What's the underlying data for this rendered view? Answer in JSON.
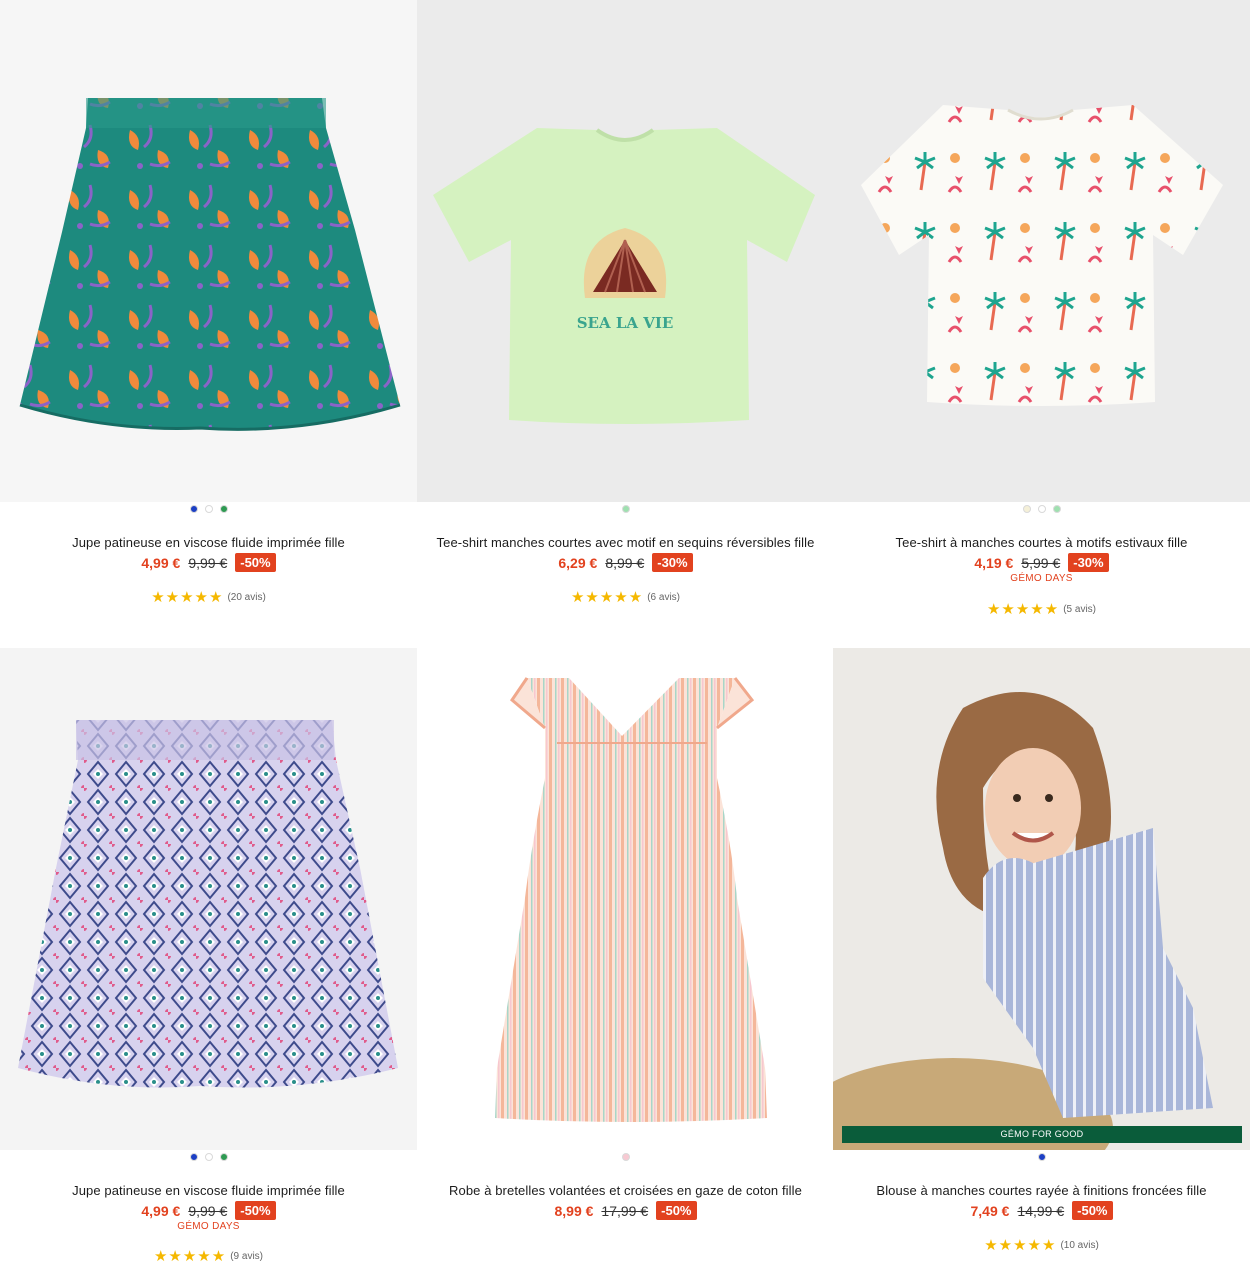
{
  "products": [
    {
      "title": "Jupe patineuse en viscose fluide imprimée fille",
      "price": "4,99 €",
      "old_price": "9,99 €",
      "discount": "-50%",
      "promo": "",
      "rating_stars": "★★★★★",
      "rating_count": "(20 avis)",
      "swatches": [
        "#1c3fc4",
        "#ffffff",
        "#2e9a52"
      ]
    },
    {
      "title": "Tee-shirt manches courtes avec motif en sequins réversibles fille",
      "price": "6,29 €",
      "old_price": "8,99 €",
      "discount": "-30%",
      "promo": "",
      "rating_stars": "★★★★★",
      "rating_count": "(6 avis)",
      "swatches": [
        "#9fe0b0"
      ],
      "print_text": "SEA LA VIE"
    },
    {
      "title": "Tee-shirt à manches courtes à motifs estivaux fille",
      "price": "4,19 €",
      "old_price": "5,99 €",
      "discount": "-30%",
      "promo": "GÉMO DAYS",
      "rating_stars": "★★★★★",
      "rating_count": "(5 avis)",
      "swatches": [
        "#f5f0d8",
        "#ffffff",
        "#9fe0b0"
      ]
    },
    {
      "title": "Jupe patineuse en viscose fluide imprimée fille",
      "price": "4,99 €",
      "old_price": "9,99 €",
      "discount": "-50%",
      "promo": "GÉMO DAYS",
      "rating_stars": "★★★★★",
      "rating_count": "(9 avis)",
      "swatches": [
        "#1c3fc4",
        "#ffffff",
        "#2e9a52"
      ]
    },
    {
      "title": "Robe à bretelles volantées et croisées en gaze de coton fille",
      "price": "8,99 €",
      "old_price": "17,99 €",
      "discount": "-50%",
      "promo": "",
      "rating_stars": "",
      "rating_count": "",
      "swatches": [
        "#f7c9d2"
      ]
    },
    {
      "title": "Blouse à manches courtes rayée à finitions froncées fille",
      "price": "7,49 €",
      "old_price": "14,99 €",
      "discount": "-50%",
      "promo": "",
      "rating_stars": "★★★★★",
      "rating_count": "(10 avis)",
      "swatches": [
        "#1c3fc4"
      ],
      "banner": "GÉMO FOR GOOD"
    }
  ],
  "colors": {
    "price_red": "#e2421f",
    "star_yellow": "#f5b800",
    "banner_green": "#0a5c3a"
  }
}
